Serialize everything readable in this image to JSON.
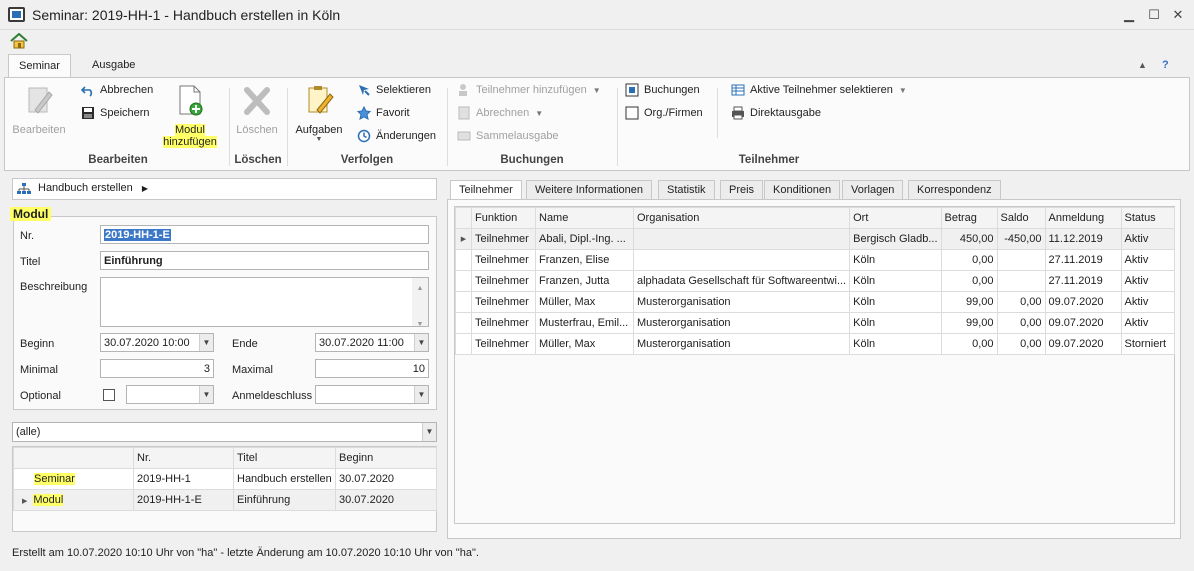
{
  "window": {
    "title": "Seminar: 2019-HH-1 - Handbuch erstellen in Köln",
    "minimize": "▁",
    "maximize": "☐",
    "close": "✕"
  },
  "ribbon": {
    "tabs": [
      "Seminar",
      "Ausgabe"
    ],
    "help": "?",
    "collapse": "▲",
    "groups": {
      "bearbeiten": {
        "label": "Bearbeiten",
        "bearbeiten": "Bearbeiten",
        "abbrechen": "Abbrechen",
        "speichern": "Speichern",
        "modul_line1": "Modul",
        "modul_line2": "hinzufügen"
      },
      "loeschen": {
        "label": "Löschen",
        "loeschen": "Löschen"
      },
      "verfolgen": {
        "label": "Verfolgen",
        "aufgaben": "Aufgaben",
        "selektieren": "Selektieren",
        "favorit": "Favorit",
        "aenderungen": "Änderungen"
      },
      "buchungen": {
        "label": "Buchungen",
        "teilnehmer_hinzufuegen": "Teilnehmer hinzufügen",
        "abrechnen": "Abrechnen",
        "sammelausgabe": "Sammelausgabe"
      },
      "teilnehmer": {
        "label": "Teilnehmer",
        "buchungen": "Buchungen",
        "org_firmen": "Org./Firmen",
        "aktive_selektieren": "Aktive Teilnehmer selektieren",
        "direktausgabe": "Direktausgabe"
      }
    }
  },
  "breadcrumb": {
    "text": "Handbuch erstellen",
    "arrow": "▶"
  },
  "modul": {
    "title": "Modul",
    "nr_label": "Nr.",
    "nr_value": "2019-HH-1-E",
    "titel_label": "Titel",
    "titel_value": "Einführung",
    "beschreibung_label": "Beschreibung",
    "beginn_label": "Beginn",
    "beginn_value": "30.07.2020 10:00",
    "ende_label": "Ende",
    "ende_value": "30.07.2020 11:00",
    "minimal_label": "Minimal",
    "minimal_value": "3",
    "maximal_label": "Maximal",
    "maximal_value": "10",
    "optional_label": "Optional",
    "anmeldeschluss_label": "Anmeldeschluss"
  },
  "filter": {
    "value": "(alle)"
  },
  "module_table": {
    "headers": [
      "Nr.",
      "Titel",
      "Beginn"
    ],
    "rows": [
      {
        "typ": "Seminar",
        "nr": "2019-HH-1",
        "titel": "Handbuch erstellen",
        "beginn": "30.07.2020"
      },
      {
        "typ": "Modul",
        "nr": "2019-HH-1-E",
        "titel": "Einführung",
        "beginn": "30.07.2020"
      }
    ]
  },
  "panel_tabs": [
    "Teilnehmer",
    "Weitere Informationen",
    "Statistik",
    "Preis",
    "Konditionen",
    "Vorlagen",
    "Korrespondenz"
  ],
  "teilnehmer_table": {
    "headers": [
      "Funktion",
      "Name",
      "Organisation",
      "Ort",
      "Betrag",
      "Saldo",
      "Anmeldung",
      "Status"
    ],
    "rows": [
      [
        "Teilnehmer",
        "Abali, Dipl.-Ing. ...",
        "",
        "Bergisch Gladb...",
        "450,00",
        "-450,00",
        "11.12.2019",
        "Aktiv"
      ],
      [
        "Teilnehmer",
        "Franzen, Elise",
        "",
        "Köln",
        "0,00",
        "",
        "27.11.2019",
        "Aktiv"
      ],
      [
        "Teilnehmer",
        "Franzen, Jutta",
        "alphadata Gesellschaft für Softwareentwi...",
        "Köln",
        "0,00",
        "",
        "27.11.2019",
        "Aktiv"
      ],
      [
        "Teilnehmer",
        "Müller, Max",
        "Musterorganisation",
        "Köln",
        "99,00",
        "0,00",
        "09.07.2020",
        "Aktiv"
      ],
      [
        "Teilnehmer",
        "Musterfrau, Emil...",
        "Musterorganisation",
        "Köln",
        "99,00",
        "0,00",
        "09.07.2020",
        "Aktiv"
      ],
      [
        "Teilnehmer",
        "Müller, Max",
        "Musterorganisation",
        "Köln",
        "0,00",
        "0,00",
        "09.07.2020",
        "Storniert"
      ]
    ]
  },
  "status_bar": "Erstellt am 10.07.2020 10:10 Uhr von \"ha\" - letzte Änderung am 10.07.2020 10:10 Uhr von \"ha\".",
  "colors": {
    "highlight": "#ffff66",
    "accent": "#2a6fb5",
    "selection": "#3c78c8"
  }
}
